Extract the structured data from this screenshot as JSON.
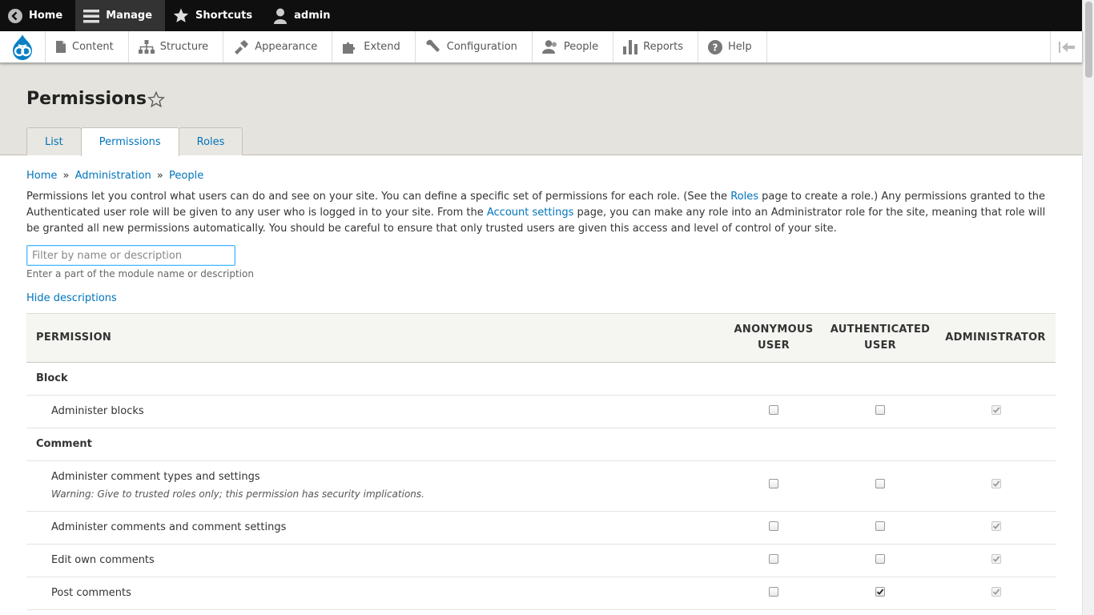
{
  "toolbar": {
    "home": "Home",
    "manage": "Manage",
    "shortcuts": "Shortcuts",
    "user": "admin"
  },
  "tray": {
    "items": [
      {
        "label": "Content",
        "icon": "file-icon"
      },
      {
        "label": "Structure",
        "icon": "structure-icon"
      },
      {
        "label": "Appearance",
        "icon": "brush-icon"
      },
      {
        "label": "Extend",
        "icon": "puzzle-icon"
      },
      {
        "label": "Configuration",
        "icon": "wrench-icon"
      },
      {
        "label": "People",
        "icon": "people-icon"
      },
      {
        "label": "Reports",
        "icon": "bar-chart-icon"
      },
      {
        "label": "Help",
        "icon": "help-icon"
      }
    ]
  },
  "page": {
    "title": "Permissions",
    "tabs": [
      {
        "label": "List",
        "active": false
      },
      {
        "label": "Permissions",
        "active": true
      },
      {
        "label": "Roles",
        "active": false
      }
    ]
  },
  "breadcrumb": {
    "home": "Home",
    "administration": "Administration",
    "people": "People",
    "separator": "»"
  },
  "intro": {
    "part1": "Permissions let you control what users can do and see on your site. You can define a specific set of permissions for each role. (See the ",
    "roles_link": "Roles",
    "part2": " page to create a role.) Any permissions granted to the Authenticated user role will be given to any user who is logged in to your site. From the ",
    "account_link": "Account settings",
    "part3": " page, you can make any role into an Administrator role for the site, meaning that role will be granted all new permissions automatically. You should be careful to ensure that only trusted users are given this access and level of control of your site."
  },
  "filter": {
    "placeholder": "Filter by name or description",
    "help": "Enter a part of the module name or description"
  },
  "hide_descriptions": "Hide descriptions",
  "table": {
    "headers": {
      "permission": "PERMISSION",
      "anonymous_line1": "ANONYMOUS",
      "anonymous_line2": "USER",
      "authenticated_line1": "AUTHENTICATED",
      "authenticated_line2": "USER",
      "administrator": "ADMINISTRATOR"
    },
    "modules": [
      {
        "name": "Block"
      },
      {
        "name": "Comment"
      }
    ],
    "permissions": [
      {
        "name": "Administer blocks",
        "anonymous": false,
        "authenticated": false,
        "administrator": true
      },
      {
        "name": "Administer comment types and settings",
        "warning": "Warning: Give to trusted roles only; this permission has security implications.",
        "anonymous": false,
        "authenticated": false,
        "administrator": true
      },
      {
        "name": "Administer comments and comment settings",
        "anonymous": false,
        "authenticated": false,
        "administrator": true
      },
      {
        "name": "Edit own comments",
        "anonymous": false,
        "authenticated": false,
        "administrator": true
      },
      {
        "name": "Post comments",
        "anonymous": false,
        "authenticated": true,
        "administrator": true
      }
    ]
  },
  "colors": {
    "link": "#0074bd",
    "toolbar_bg": "#0f0f0f",
    "header_bg": "#e4e3dd"
  }
}
